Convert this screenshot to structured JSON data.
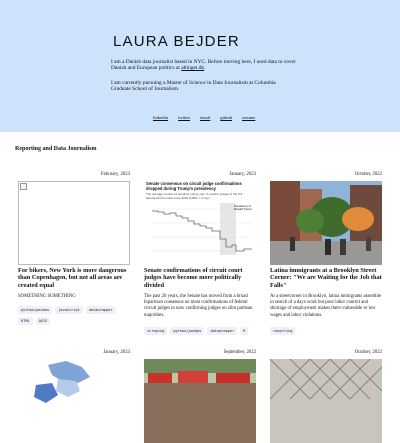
{
  "header": {
    "name": "LAURA BEJDER",
    "bio_1_before_link": "I am a Danish data journalist based in NYC. Before moving here, I used data to cover Danish and European politics at ",
    "bio_1_link": "altinget.dk",
    "bio_1_after_link": ".",
    "bio_2": "I am currently pursuing a Master of Science in Data Journalism at Columbia Graduate School of Journalism.",
    "links": [
      "linkedin",
      "twitter",
      "email",
      "github",
      "resume"
    ]
  },
  "section_title": "Reporting and Data Journalism",
  "cards": [
    {
      "date": "February, 2023",
      "title": "For bikers, New York is more dangerous than Copenhagen, but not all areas are created equal",
      "desc": "SOMETHING SOMETHING",
      "tags": [
        "python/pandas",
        "javascript",
        "datawrapper",
        "HTML",
        "QGIS"
      ],
      "thumb": "broken-image"
    },
    {
      "date": "January, 2023",
      "title": "Senate confirmations of circuit court judges have become more politically divided",
      "desc": "The past 20 years, the Senate has moved from a broad bipartisan consensus on most confirmations of federal circuit judges to now confirming judges on slim partisan majorities.",
      "tags": [
        "scraping",
        "python/pandas",
        "datawrapper",
        "R"
      ],
      "thumb": "chart",
      "thumb_title": "Senate consensus on circuit judge confirmations dropped during Trump's presidency",
      "thumb_subtitle": "The average number of senators voting 'nay' to confirm judges to the US federal circuit courts since 2001 (100% = 3 nay)",
      "thumb_label": "Presidency of Donald Trump"
    },
    {
      "date": "October, 2022",
      "title": "Latina immigrants at a Brooklyn Street Corner: \"We are Waiting for the Job that Falls\"",
      "desc": "At a streetcorner in Brooklyn, latina immigrants assemble in search of a days work but poor labor control and shortage of employment makes them vulnerable to low wages and labor violations.",
      "tags": [
        "reporting"
      ],
      "thumb": "photo-street"
    },
    {
      "date": "January, 2023",
      "thumb": "map"
    },
    {
      "date": "September, 2022",
      "thumb": "photo-crowd"
    },
    {
      "date": "October, 2022",
      "thumb": "photo-fence"
    }
  ],
  "colors": {
    "header_bg": "#cce3fb",
    "tag_bg": "#eef1f5"
  }
}
